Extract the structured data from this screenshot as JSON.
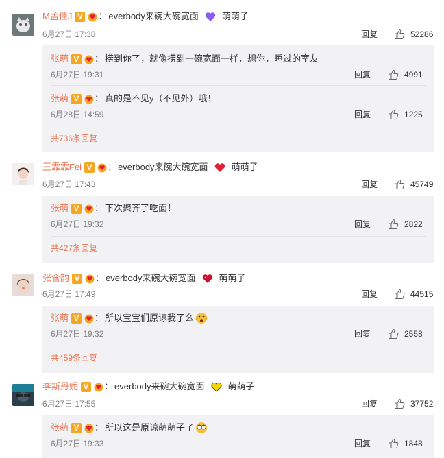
{
  "icons": {
    "reply_like": "thumb-up-icon",
    "vip": "v-badge",
    "fan": "fan-badge",
    "heart": "heart-icon",
    "emoji": "emoji-face-icon"
  },
  "colors": {
    "username": "#eb7350",
    "reply_box": "#f2f2f5",
    "heart_purple": "#8b5cf6",
    "heart_red": "#e02030",
    "heart_yellow": "#f5d800",
    "badge": "#f5a623"
  },
  "comments": [
    {
      "user": "M孟佳J",
      "content": "everbody来碗大碗宽面",
      "heart_label": "萌萌子",
      "time": "6月27日 17:38",
      "reply_label": "回复",
      "likes": "52286",
      "replies": [
        {
          "user": "张萌",
          "content": "捞到你了，就像捞到一碗宽面一样，想你，睡过的室友",
          "time": "6月27日 19:31",
          "reply_label": "回复",
          "likes": "4991"
        },
        {
          "user": "张萌",
          "content": "真的是不见y（不见外）哦！",
          "time": "6月28日 14:59",
          "reply_label": "回复",
          "likes": "1225"
        }
      ],
      "more": "共736条回复"
    },
    {
      "user": "王霏霏Fei",
      "content": "everbody来碗大碗宽面",
      "heart_label": "萌萌子",
      "time": "6月27日 17:43",
      "reply_label": "回复",
      "likes": "45749",
      "replies": [
        {
          "user": "张萌",
          "content": "下次聚齐了吃面！",
          "time": "6月27日 19:32",
          "reply_label": "回复",
          "likes": "2822"
        }
      ],
      "more": "共427条回复"
    },
    {
      "user": "张含韵",
      "content": "everbody来碗大碗宽面",
      "heart_label": "萌萌子",
      "time": "6月27日 17:49",
      "reply_label": "回复",
      "likes": "44515",
      "replies": [
        {
          "user": "张萌",
          "content": "所以宝宝们原谅我了么",
          "time": "6月27日 19:32",
          "reply_label": "回复",
          "likes": "2558"
        }
      ],
      "more": "共459条回复"
    },
    {
      "user": "李斯丹妮",
      "content": "everbody来碗大碗宽面",
      "heart_label": "萌萌子",
      "time": "6月27日 17:55",
      "reply_label": "回复",
      "likes": "37752",
      "replies": [
        {
          "user": "张萌",
          "content": "所以这是原谅萌萌子了",
          "time": "6月27日 19:33",
          "reply_label": "回复",
          "likes": "1848"
        }
      ]
    }
  ]
}
